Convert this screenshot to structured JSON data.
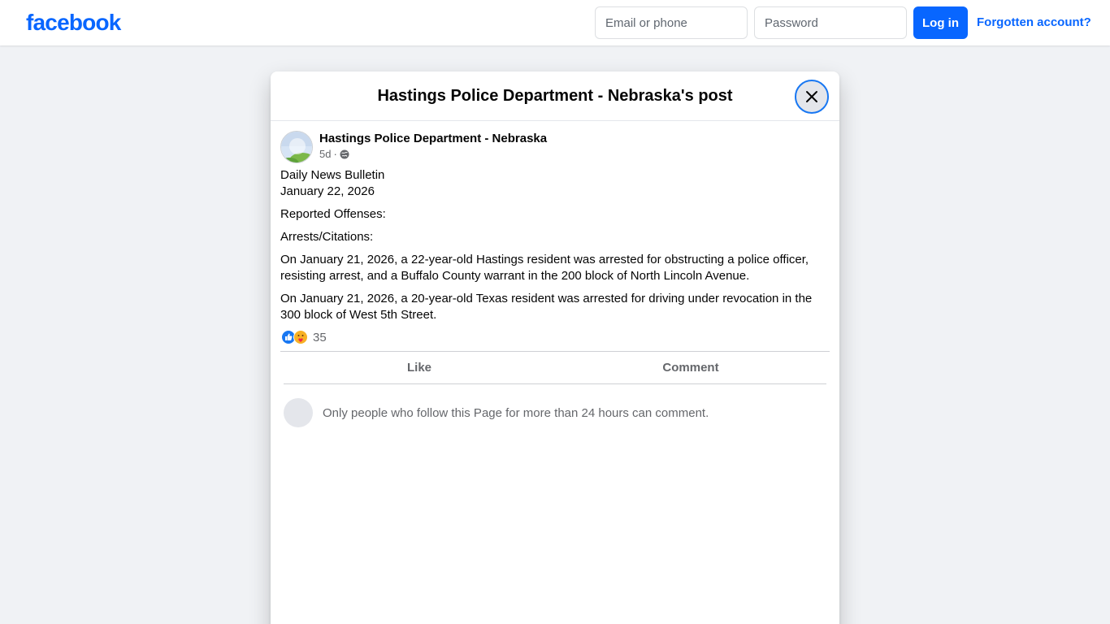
{
  "topbar": {
    "logo_text": "facebook",
    "email_placeholder": "Email or phone",
    "password_placeholder": "Password",
    "login_label": "Log in",
    "forgot_label": "Forgotten account?",
    "brand_color": "#0866ff"
  },
  "modal": {
    "title": "Hastings Police Department - Nebraska's post",
    "close_icon": "close-icon"
  },
  "post": {
    "author": "Hastings Police Department - Nebraska",
    "time": "5d",
    "separator": "·",
    "privacy_icon": "globe-icon",
    "lines": {
      "bulletin": "Daily News Bulletin",
      "date": "January 22, 2026",
      "reported": "Reported Offenses:",
      "arrests": "Arrests/Citations:",
      "item1": "On January 21, 2026, a 22-year-old Hastings resident was arrested for obstructing a police officer, resisting arrest, and a Buffalo County warrant in the 200 block of North Lincoln Avenue.",
      "item2": "On January 21, 2026, a 20-year-old Texas resident was arrested for driving under revocation in the 300 block of West 5th Street."
    },
    "reactions": {
      "icons": [
        "like-icon",
        "care-icon"
      ],
      "count": "35"
    },
    "actions": {
      "like_label": "Like",
      "comment_label": "Comment"
    },
    "comment_notice": "Only people who follow this Page for more than 24 hours can comment."
  }
}
